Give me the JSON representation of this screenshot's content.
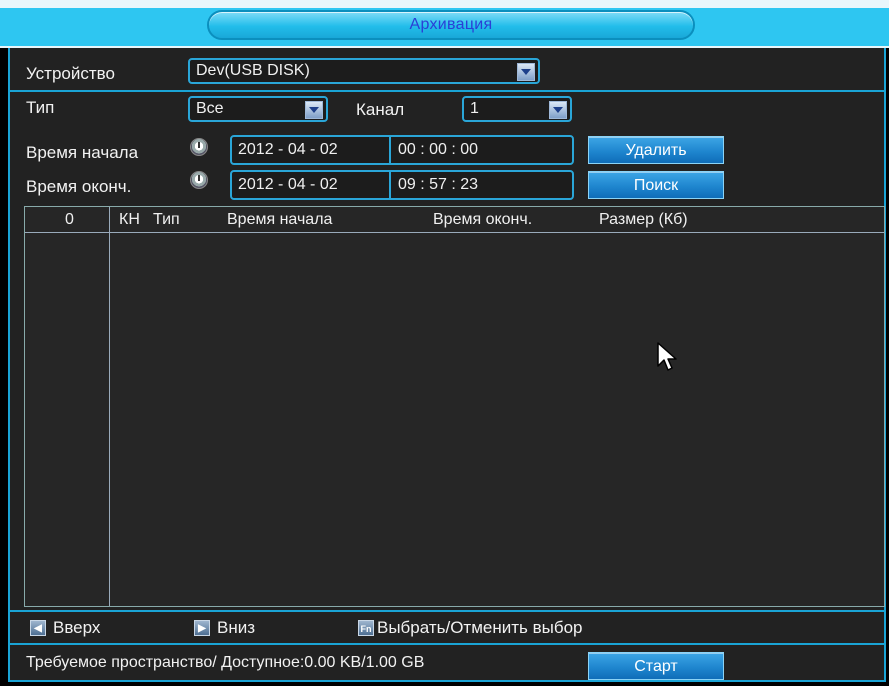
{
  "window": {
    "title": "Архивация"
  },
  "form": {
    "device_label": "Устройство",
    "device_value": "Dev(USB DISK)",
    "type_label": "Тип",
    "type_value": "Все",
    "channel_label": "Канал",
    "channel_value": "1",
    "start_label": "Время начала",
    "start_date": "2012  - 04 - 02",
    "start_time": "00 :  00 :  00",
    "end_label": "Время оконч.",
    "end_date": "2012  - 04 - 02",
    "end_time": "09 :  57 :  23"
  },
  "buttons": {
    "delete": "Удалить",
    "search": "Поиск",
    "start": "Старт"
  },
  "table": {
    "columns": [
      "0",
      "КН",
      "Тип",
      "Время начала",
      "Время оконч.",
      "Размер (Кб)"
    ],
    "rows": []
  },
  "footer": {
    "up_key": "Вверх",
    "down_key": "Вниз",
    "fn_key": "Выбрать/Отменить выбор",
    "fn_icon": "Fn",
    "space_text": "Требуемое пространство/ Доступное:0.00 KB/1.00 GB"
  },
  "icons": {
    "dropdown": "dropdown-arrow-icon",
    "clock": "clock-icon",
    "up": "up-key-icon",
    "down": "down-key-icon",
    "fn": "fn-key-icon",
    "cursor": "mouse-cursor-icon"
  },
  "colors": {
    "accent": "#1aa4d6",
    "panel": "#222222",
    "title_text": "#2a3fd6",
    "button": "#1f86cf"
  }
}
